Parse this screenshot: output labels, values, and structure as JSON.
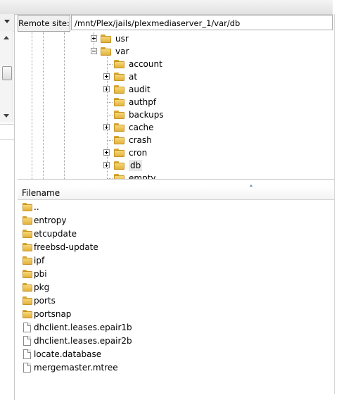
{
  "remote_site": {
    "label": "Remote site:",
    "path": "/mnt/Plex/jails/plexmediaserver_1/var/db"
  },
  "tree": {
    "items": [
      {
        "label": "usr",
        "expander": "plus"
      },
      {
        "label": "var",
        "expander": "minus"
      },
      {
        "label": "account",
        "expander": "none"
      },
      {
        "label": "at",
        "expander": "plus"
      },
      {
        "label": "audit",
        "expander": "plus"
      },
      {
        "label": "authpf",
        "expander": "none"
      },
      {
        "label": "backups",
        "expander": "none"
      },
      {
        "label": "cache",
        "expander": "plus"
      },
      {
        "label": "crash",
        "expander": "none"
      },
      {
        "label": "cron",
        "expander": "plus"
      },
      {
        "label": "db",
        "expander": "plus",
        "selected": true
      },
      {
        "label": "empty",
        "expander": "none"
      }
    ]
  },
  "file_list": {
    "column_filename": "Filename",
    "rows": [
      {
        "name": "..",
        "type": "folder"
      },
      {
        "name": "entropy",
        "type": "folder"
      },
      {
        "name": "etcupdate",
        "type": "folder"
      },
      {
        "name": "freebsd-update",
        "type": "folder"
      },
      {
        "name": "ipf",
        "type": "folder"
      },
      {
        "name": "pbi",
        "type": "folder"
      },
      {
        "name": "pkg",
        "type": "folder"
      },
      {
        "name": "ports",
        "type": "folder"
      },
      {
        "name": "portsnap",
        "type": "folder"
      },
      {
        "name": "dhclient.leases.epair1b",
        "type": "file"
      },
      {
        "name": "dhclient.leases.epair2b",
        "type": "file"
      },
      {
        "name": "locate.database",
        "type": "file"
      },
      {
        "name": "mergemaster.mtree",
        "type": "file"
      }
    ]
  },
  "colors": {
    "folder": "#e3b23c",
    "selected_bg": "#e8e8e8"
  }
}
